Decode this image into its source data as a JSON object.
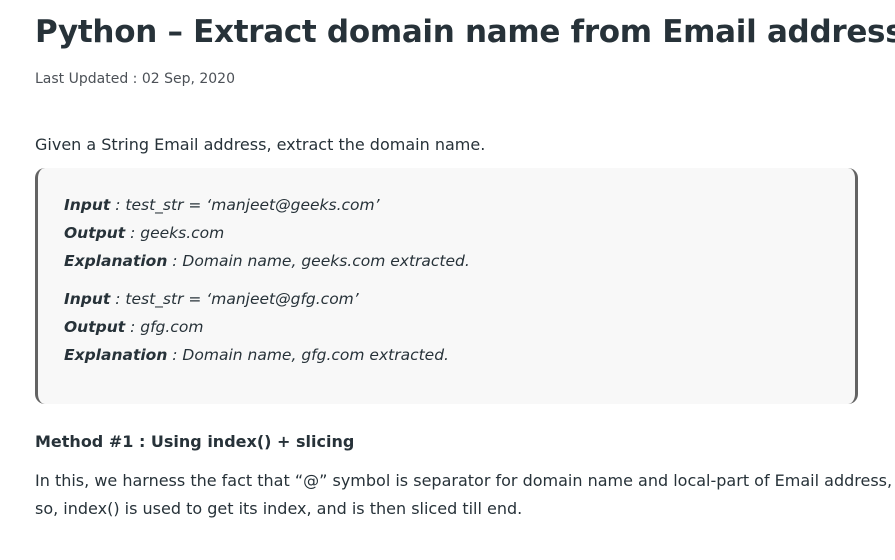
{
  "article": {
    "title": "Python – Extract domain name from Email address",
    "last_updated": "Last Updated : 02 Sep, 2020",
    "intro": "Given a String Email address, extract the domain name."
  },
  "examples": [
    {
      "input_label": "Input",
      "input_value": " : test_str = ‘manjeet@geeks.com’",
      "output_label": "Output",
      "output_value": " : geeks.com",
      "explanation_label": "Explanation",
      "explanation_value": " : Domain name, geeks.com extracted."
    },
    {
      "input_label": "Input",
      "input_value": " : test_str = ‘manjeet@gfg.com’",
      "output_label": "Output",
      "output_value": " : gfg.com",
      "explanation_label": "Explanation",
      "explanation_value": " : Domain name, gfg.com extracted."
    }
  ],
  "method": {
    "heading": "Method #1 : Using index() + slicing",
    "description_line1": "In this, we harness the fact that “@” symbol is separator for domain name and local-part of Email address,",
    "description_line2": "so, index() is used to get its index, and is then sliced till end."
  }
}
